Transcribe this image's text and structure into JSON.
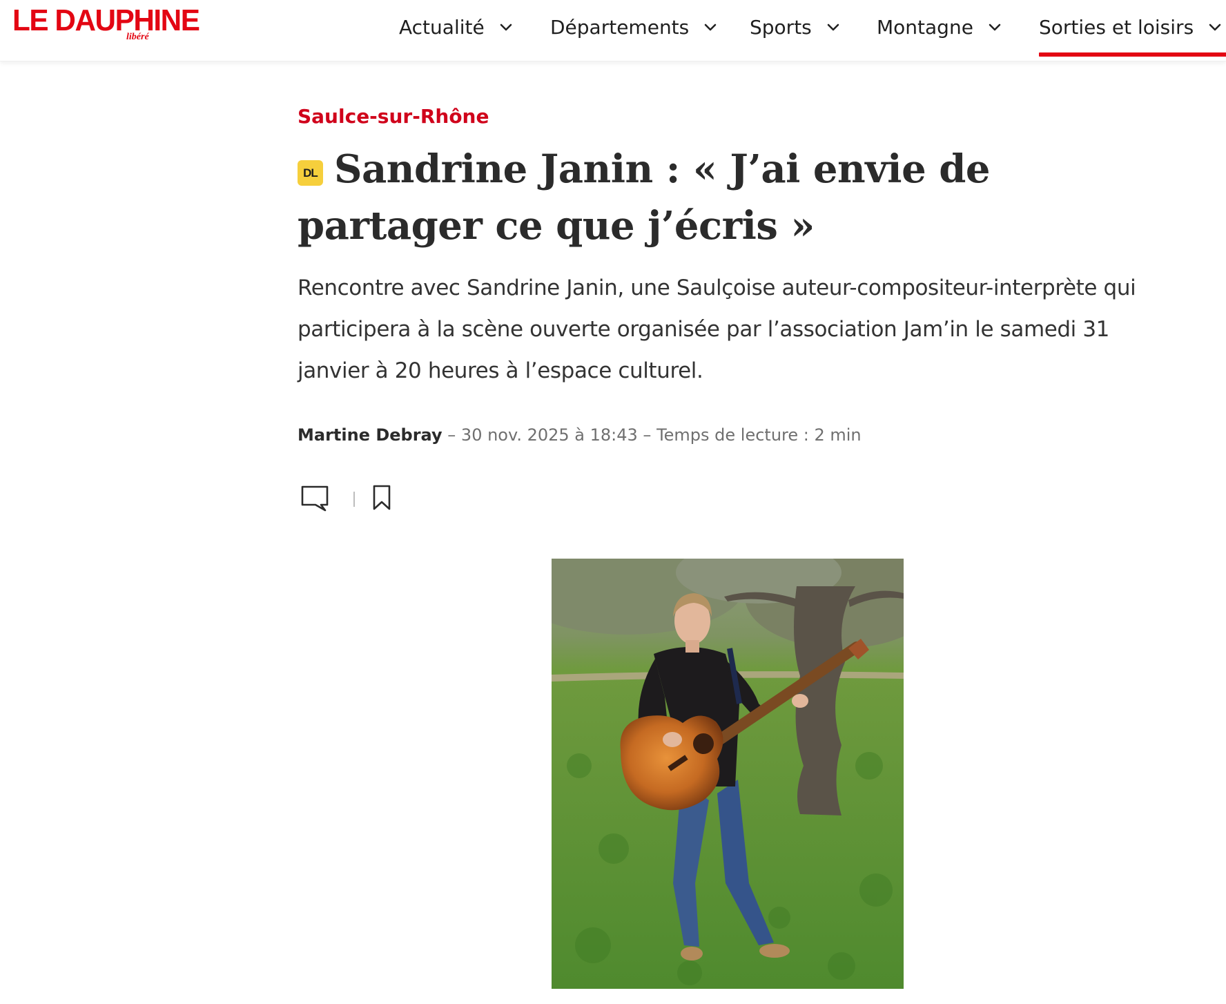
{
  "brand": {
    "name": "LE DAUPHINE",
    "sub": "libéré",
    "accent": "#e30613"
  },
  "nav": {
    "items": [
      {
        "label": "Actualité",
        "active": false
      },
      {
        "label": "Départements",
        "active": false
      },
      {
        "label": "Sports",
        "active": false
      },
      {
        "label": "Montagne",
        "active": false
      },
      {
        "label": "Sorties et loisirs",
        "active": true
      }
    ],
    "chevron_icon": "chevron-down-icon"
  },
  "article": {
    "kicker": "Saulce-sur-Rhône",
    "badge": "DL",
    "title": "Sandrine Janin : « J’ai envie de partager ce que j’écris »",
    "lead": "Rencontre avec Sandrine Janin, une Saulçoise auteur-compositeur-interprète qui participera à la scène ouverte organisée par l’association Jam’in le samedi 31 janvier à 20 heures à l’espace culturel.",
    "author": "Martine Debray",
    "date": "30 nov. 2025 à 18:43",
    "reading_time": "Temps de lecture : 2 min",
    "separator": " – "
  },
  "actions": {
    "comment_icon": "comment-icon",
    "bookmark_icon": "bookmark-icon"
  },
  "photo": {
    "subject": "woman-with-acoustic-guitar-photo"
  }
}
